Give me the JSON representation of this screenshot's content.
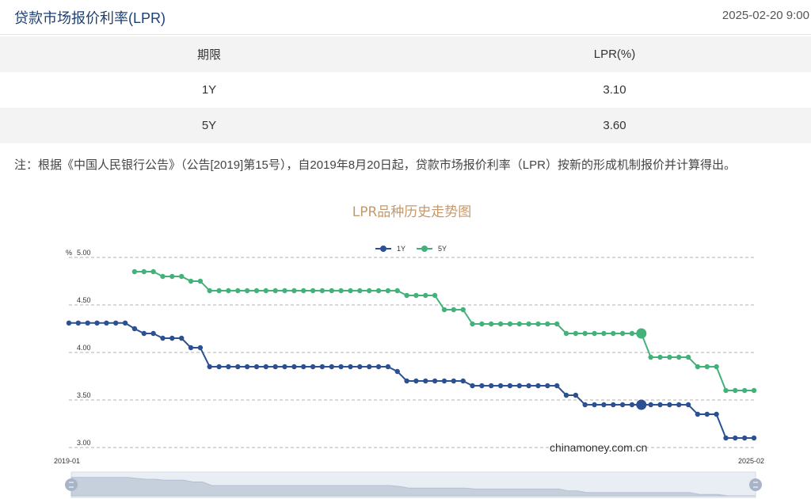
{
  "header": {
    "title": "贷款市场报价利率(LPR)",
    "datetime": "2025-02-20 9:00"
  },
  "table": {
    "columns": [
      "期限",
      "LPR(%)"
    ],
    "rows": [
      {
        "term": "1Y",
        "rate": "3.10"
      },
      {
        "term": "5Y",
        "rate": "3.60"
      }
    ]
  },
  "note": "注：根据《中国人民银行公告》（公告[2019]第15号），自2019年8月20日起，贷款市场报价利率（LPR）按新的形成机制报价并计算得出。",
  "watermark": "chinamoney.com.cn",
  "colors": {
    "series_1y": "#2b5193",
    "series_5y": "#42b27a",
    "title": "#c49a6c",
    "grid": "#999999"
  },
  "chart_data": {
    "type": "line",
    "title": "LPR品种历史走势图",
    "ylabel": "%",
    "ylim": [
      3.0,
      5.0
    ],
    "yticks": [
      "5.00",
      "4.50",
      "4.00",
      "3.50",
      "3.00"
    ],
    "x_range_labels": [
      "2019-01",
      "2025-02"
    ],
    "legend_position": "top-center",
    "grid": "horizontal-dashed",
    "x": [
      "2019-01",
      "2019-02",
      "2019-03",
      "2019-04",
      "2019-05",
      "2019-06",
      "2019-07",
      "2019-08",
      "2019-09",
      "2019-10",
      "2019-11",
      "2019-12",
      "2020-01",
      "2020-02",
      "2020-03",
      "2020-04",
      "2020-05",
      "2020-06",
      "2020-07",
      "2020-08",
      "2020-09",
      "2020-10",
      "2020-11",
      "2020-12",
      "2021-01",
      "2021-02",
      "2021-03",
      "2021-04",
      "2021-05",
      "2021-06",
      "2021-07",
      "2021-08",
      "2021-09",
      "2021-10",
      "2021-11",
      "2021-12",
      "2022-01",
      "2022-02",
      "2022-03",
      "2022-04",
      "2022-05",
      "2022-06",
      "2022-07",
      "2022-08",
      "2022-09",
      "2022-10",
      "2022-11",
      "2022-12",
      "2023-01",
      "2023-02",
      "2023-03",
      "2023-04",
      "2023-05",
      "2023-06",
      "2023-07",
      "2023-08",
      "2023-09",
      "2023-10",
      "2023-11",
      "2023-12",
      "2024-01",
      "2024-02",
      "2024-03",
      "2024-04",
      "2024-05",
      "2024-06",
      "2024-07",
      "2024-08",
      "2024-09",
      "2024-10",
      "2024-11",
      "2024-12",
      "2025-01",
      "2025-02"
    ],
    "series": [
      {
        "name": "1Y",
        "values": [
          4.31,
          4.31,
          4.31,
          4.31,
          4.31,
          4.31,
          4.31,
          4.25,
          4.2,
          4.2,
          4.15,
          4.15,
          4.15,
          4.05,
          4.05,
          3.85,
          3.85,
          3.85,
          3.85,
          3.85,
          3.85,
          3.85,
          3.85,
          3.85,
          3.85,
          3.85,
          3.85,
          3.85,
          3.85,
          3.85,
          3.85,
          3.85,
          3.85,
          3.85,
          3.85,
          3.8,
          3.7,
          3.7,
          3.7,
          3.7,
          3.7,
          3.7,
          3.7,
          3.65,
          3.65,
          3.65,
          3.65,
          3.65,
          3.65,
          3.65,
          3.65,
          3.65,
          3.65,
          3.55,
          3.55,
          3.45,
          3.45,
          3.45,
          3.45,
          3.45,
          3.45,
          3.45,
          3.45,
          3.45,
          3.45,
          3.45,
          3.45,
          3.35,
          3.35,
          3.35,
          3.1,
          3.1,
          3.1,
          3.1
        ]
      },
      {
        "name": "5Y",
        "values": [
          null,
          null,
          null,
          null,
          null,
          null,
          null,
          4.85,
          4.85,
          4.85,
          4.8,
          4.8,
          4.8,
          4.75,
          4.75,
          4.65,
          4.65,
          4.65,
          4.65,
          4.65,
          4.65,
          4.65,
          4.65,
          4.65,
          4.65,
          4.65,
          4.65,
          4.65,
          4.65,
          4.65,
          4.65,
          4.65,
          4.65,
          4.65,
          4.65,
          4.65,
          4.6,
          4.6,
          4.6,
          4.6,
          4.45,
          4.45,
          4.45,
          4.3,
          4.3,
          4.3,
          4.3,
          4.3,
          4.3,
          4.3,
          4.3,
          4.3,
          4.3,
          4.2,
          4.2,
          4.2,
          4.2,
          4.2,
          4.2,
          4.2,
          4.2,
          4.2,
          3.95,
          3.95,
          3.95,
          3.95,
          3.95,
          3.85,
          3.85,
          3.85,
          3.6,
          3.6,
          3.6,
          3.6
        ]
      }
    ],
    "highlight_index": 61
  }
}
